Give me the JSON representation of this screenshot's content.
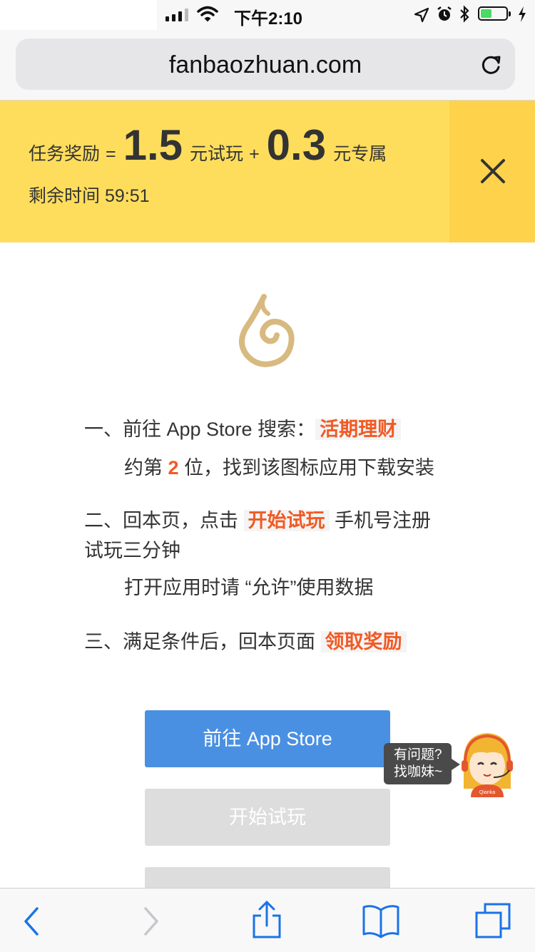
{
  "status_bar": {
    "time": "下午2:10",
    "battery_level": 0.45,
    "icons": [
      "signal-icon",
      "wifi-icon",
      "location-icon",
      "alarm-icon",
      "bluetooth-icon",
      "battery-icon",
      "charging-icon"
    ]
  },
  "address_bar": {
    "url": "fanbaozhuan.com",
    "reload_icon": "reload-icon"
  },
  "banner": {
    "reward_label": "任务奖励",
    "equals": "=",
    "trial_amount": "1.5",
    "trial_unit": "元试玩",
    "plus": "+",
    "exclusive_amount": "0.3",
    "exclusive_unit": "元专属",
    "remaining_label": "剩余时间",
    "remaining_time": "59:51",
    "close_icon": "close-icon"
  },
  "steps": {
    "step1_prefix": "一、前往 App Store 搜索：",
    "step1_keyword": "活期理财",
    "step1_rank_prefix": "约第",
    "step1_rank": "2",
    "step1_rank_suffix": "位，找到该图标应用下载安装",
    "step2_prefix": "二、回本页，点击",
    "step2_keyword": "开始试玩",
    "step2_suffix": "手机号注册",
    "step2_line2": "试玩三分钟",
    "step2_note": "打开应用时请 “允许”使用数据",
    "step3_prefix": "三、满足条件后，回本页面",
    "step3_keyword": "领取奖励"
  },
  "buttons": {
    "goto_appstore": "前往 App Store",
    "start_trial": "开始试玩"
  },
  "helper": {
    "line1": "有问题?",
    "line2": "找咖妹~",
    "badge": "Qianka"
  },
  "colors": {
    "banner_bg": "#ffdd5c",
    "accent_red": "#f15a24",
    "primary_blue": "#4a90e2",
    "disabled_gray": "#dddddd",
    "ios_blue": "#1a73e8"
  }
}
